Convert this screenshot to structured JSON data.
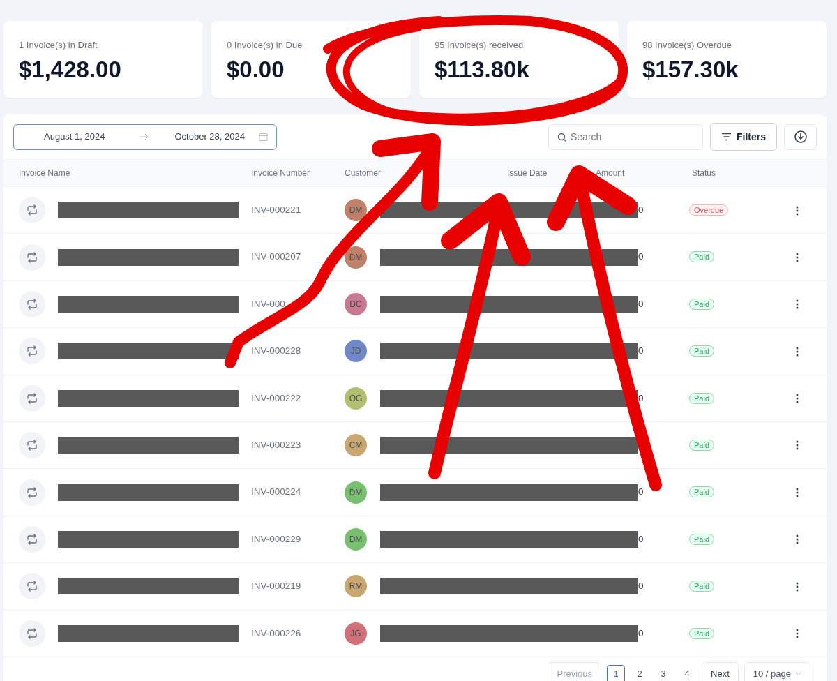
{
  "summary_cards": [
    {
      "label": "1 Invoice(s) in Draft",
      "value": "$1,428.00"
    },
    {
      "label": "0 Invoice(s) in Due",
      "value": "$0.00"
    },
    {
      "label": "95 Invoice(s) received",
      "value": "$113.80k"
    },
    {
      "label": "98 Invoice(s) Overdue",
      "value": "$157.30k"
    }
  ],
  "date_range": {
    "start": "August 1, 2024",
    "end": "October 28, 2024"
  },
  "search": {
    "placeholder": "Search"
  },
  "filters_button": "Filters",
  "table": {
    "columns": [
      "Invoice Name",
      "Invoice Number",
      "Customer",
      "Issue Date",
      "Amount",
      "Status"
    ],
    "rows": [
      {
        "number": "INV-000221",
        "initials": "DM",
        "color": "#c0806a",
        "amount": "0",
        "status": {
          "kind": "overdue",
          "text": "Overdue"
        }
      },
      {
        "number": "INV-000207",
        "initials": "DM",
        "color": "#c0806a",
        "amount": "0",
        "status": {
          "kind": "paid",
          "text": "Paid"
        }
      },
      {
        "number": "INV-000",
        "initials": "DC",
        "color": "#c87890",
        "amount": "0",
        "status": {
          "kind": "paid",
          "text": "Paid"
        }
      },
      {
        "number": "INV-000228",
        "initials": "JD",
        "color": "#7088c8",
        "amount": "0",
        "status": {
          "kind": "paid",
          "text": "Paid"
        }
      },
      {
        "number": "INV-000222",
        "initials": "OG",
        "color": "#b0c070",
        "amount": "0",
        "status": {
          "kind": "paid",
          "text": "Paid"
        }
      },
      {
        "number": "INV-000223",
        "initials": "CM",
        "color": "#c8a870",
        "status": {
          "kind": "paid",
          "text": "Paid"
        }
      },
      {
        "number": "INV-000224",
        "initials": "DM",
        "color": "#78c070",
        "amount": "0",
        "status": {
          "kind": "paid",
          "text": "Paid"
        }
      },
      {
        "number": "INV-000229",
        "initials": "DM",
        "color": "#78c070",
        "amount": "0",
        "status": {
          "kind": "paid",
          "text": "Paid"
        }
      },
      {
        "number": "INV-000219",
        "initials": "RM",
        "color": "#c8a870",
        "amount": "0",
        "status": {
          "kind": "paid",
          "text": "Paid"
        }
      },
      {
        "number": "INV-000226",
        "initials": "JG",
        "color": "#d07078",
        "amount": "0",
        "status": {
          "kind": "paid",
          "text": "Paid"
        }
      }
    ]
  },
  "pagination": {
    "previous": {
      "label": "Previous",
      "disabled": true
    },
    "pages": [
      {
        "label": "1",
        "selected": true
      },
      {
        "label": "2",
        "selected": false
      },
      {
        "label": "3",
        "selected": false
      },
      {
        "label": "4",
        "selected": false
      }
    ],
    "next": {
      "label": "Next",
      "disabled": false
    },
    "page_size": "10 / page"
  }
}
